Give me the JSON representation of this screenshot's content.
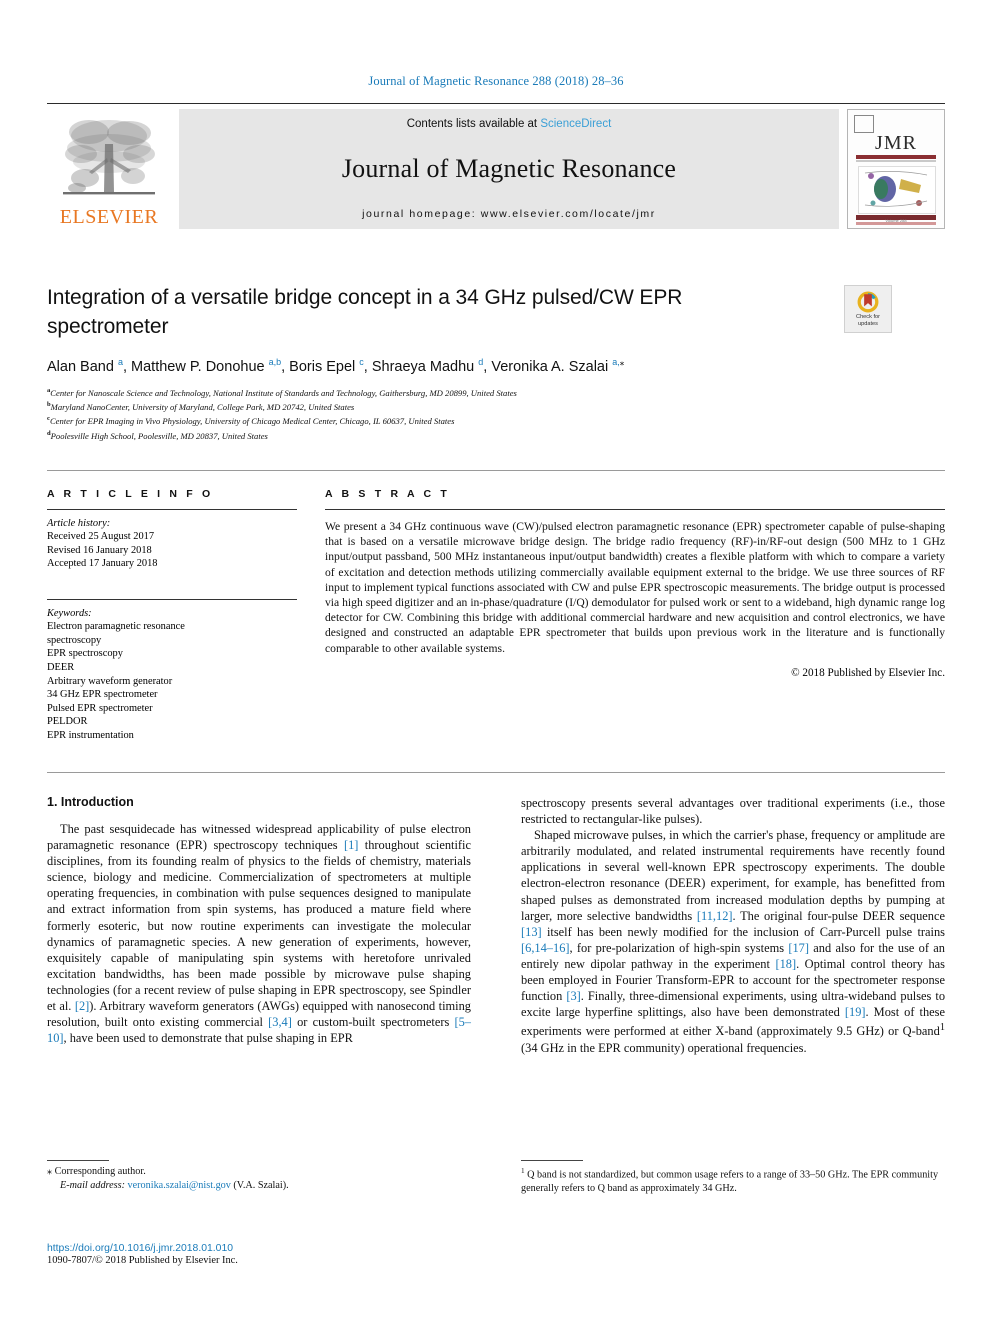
{
  "running_head": "Journal of Magnetic Resonance 288 (2018) 28–36",
  "masthead": {
    "contents_prefix": "Contents lists available at ",
    "sciencedirect": "ScienceDirect",
    "journal_title": "Journal of Magnetic Resonance",
    "homepage": "journal homepage: www.elsevier.com/locate/jmr",
    "publisher_wordmark": "ELSEVIER",
    "cover_wordmark": "JMR",
    "cover_caption": "Volume 288",
    "accent_blue": "#3a9fd6",
    "elsevier_orange": "#e87722"
  },
  "article": {
    "title": "Integration of a versatile bridge concept in a 34 GHz pulsed/CW EPR spectrometer",
    "crossmark_label_line1": "Check for",
    "crossmark_label_line2": "updates",
    "authors_html": "Alan Band <sup>a</sup>, Matthew P. Donohue <sup>a,b</sup>, Boris Epel <sup>c</sup>, Shraeya Madhu <sup>d</sup>, Veronika A. Szalai <sup>a,</sup><sup class=\"ast\">⁎</sup>",
    "affiliations": [
      {
        "marker": "a",
        "text": "Center for Nanoscale Science and Technology, National Institute of Standards and Technology, Gaithersburg, MD 20899, United States"
      },
      {
        "marker": "b",
        "text": "Maryland NanoCenter, University of Maryland, College Park, MD 20742, United States"
      },
      {
        "marker": "c",
        "text": "Center for EPR Imaging in Vivo Physiology, University of Chicago Medical Center, Chicago, IL 60637, United States"
      },
      {
        "marker": "d",
        "text": "Poolesville High School, Poolesville, MD 20837, United States"
      }
    ]
  },
  "article_info": {
    "heading": "A R T I C L E   I N F O",
    "history_label": "Article history:",
    "history": [
      "Received 25 August 2017",
      "Revised 16 January 2018",
      "Accepted 17 January 2018"
    ],
    "keywords_label": "Keywords:",
    "keywords": [
      "Electron paramagnetic resonance",
      "spectroscopy",
      "EPR spectroscopy",
      "DEER",
      "Arbitrary waveform generator",
      "34 GHz EPR spectrometer",
      "Pulsed EPR spectrometer",
      "PELDOR",
      "EPR instrumentation"
    ]
  },
  "abstract": {
    "heading": "A B S T R A C T",
    "text": "We present a 34 GHz continuous wave (CW)/pulsed electron paramagnetic resonance (EPR) spectrometer capable of pulse-shaping that is based on a versatile microwave bridge design. The bridge radio frequency (RF)-in/RF-out design (500 MHz to 1 GHz input/output passband, 500 MHz instantaneous input/output bandwidth) creates a flexible platform with which to compare a variety of excitation and detection methods utilizing commercially available equipment external to the bridge. We use three sources of RF input to implement typical functions associated with CW and pulse EPR spectroscopic measurements. The bridge output is processed via high speed digitizer and an in-phase/quadrature (I/Q) demodulator for pulsed work or sent to a wideband, high dynamic range log detector for CW. Combining this bridge with additional commercial hardware and new acquisition and control electronics, we have designed and constructed an adaptable EPR spectrometer that builds upon previous work in the literature and is functionally comparable to other available systems.",
    "copyright": "© 2018 Published by Elsevier Inc."
  },
  "body": {
    "section_heading": "1. Introduction",
    "left_para_1_html": "The past sesquidecade has witnessed widespread applicability of pulse electron paramagnetic resonance (EPR) spectroscopy techniques <span class=\"ref\">[1]</span> throughout scientific disciplines, from its founding realm of physics to the fields of chemistry, materials science, biology and medicine. Commercialization of spectrometers at multiple operating frequencies, in combination with pulse sequences designed to manipulate and extract information from spin systems, has produced a mature field where formerly esoteric, but now routine experiments can investigate the molecular dynamics of paramagnetic species. A new generation of experiments, however, exquisitely capable of manipulating spin systems with heretofore unrivaled excitation bandwidths, has been made possible by microwave pulse shaping technologies (for a recent review of pulse shaping in EPR spectroscopy, see Spindler et al. <span class=\"ref\">[2]</span>). Arbitrary waveform generators (AWGs) equipped with nanosecond timing resolution, built onto existing commercial <span class=\"ref\">[3,4]</span> or custom-built spectrometers <span class=\"ref\">[5–10]</span>, have been used to demonstrate that pulse shaping in EPR",
    "right_para_1_html": "spectroscopy presents several advantages over traditional experiments (i.e., those restricted to rectangular-like pulses).",
    "right_para_2_html": "Shaped microwave pulses, in which the carrier's phase, frequency or amplitude are arbitrarily modulated, and related instrumental requirements have recently found applications in several well-known EPR spectroscopy experiments. The double electron-electron resonance (DEER) experiment, for example, has benefitted from shaped pulses as demonstrated from increased modulation depths by pumping at larger, more selective bandwidths <span class=\"ref\">[11,12]</span>. The original four-pulse DEER sequence <span class=\"ref\">[13]</span> itself has been newly modified for the inclusion of Carr-Purcell pulse trains <span class=\"ref\">[6,14–16]</span>, for pre-polarization of high-spin systems <span class=\"ref\">[17]</span> and also for the use of an entirely new dipolar pathway in the experiment <span class=\"ref\">[18]</span>. Optimal control theory has been employed in Fourier Transform-EPR to account for the spectrometer response function <span class=\"ref\">[3]</span>. Finally, three-dimensional experiments, using ultra-wideband pulses to excite large hyperfine splittings, also have been demonstrated <span class=\"ref\">[19]</span>. Most of these experiments were performed at either X-band (approximately 9.5 GHz) or Q-band<sup>1</sup> (34 GHz in the EPR community) operational frequencies."
  },
  "footnotes": {
    "corresponding_marker": "⁎",
    "corresponding_label": "Corresponding author.",
    "email_label": "E-mail address:",
    "email": "veronika.szalai@nist.gov",
    "email_suffix": "(V.A. Szalai).",
    "note_marker": "1",
    "note_text": "Q band is not standardized, but common usage refers to a range of 33–50 GHz. The EPR community generally refers to Q band as approximately 34 GHz.",
    "doi": "https://doi.org/10.1016/j.jmr.2018.01.010",
    "issn_line": "1090-7807/© 2018 Published by Elsevier Inc."
  }
}
